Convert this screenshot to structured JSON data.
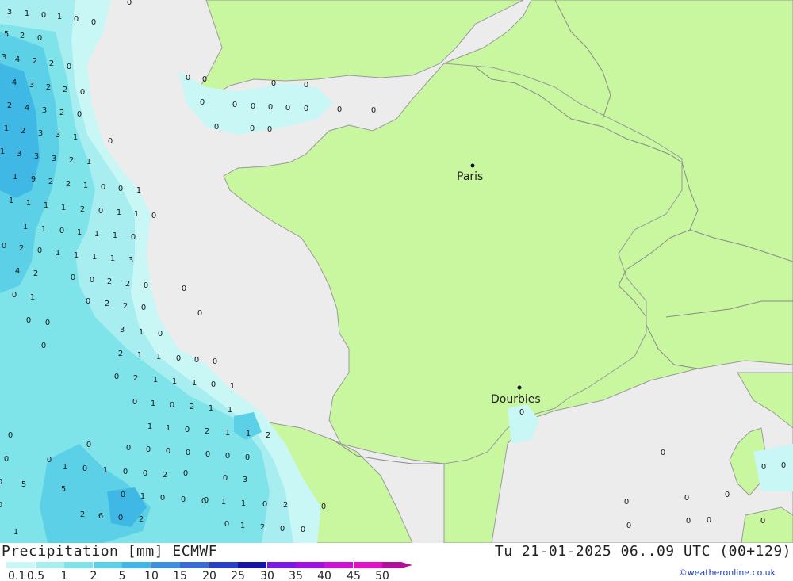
{
  "footer": {
    "title": "Precipitation [mm] ECMWF",
    "valid_time": "Tu 21-01-2025 06..09 UTC (00+129)",
    "credit": "©weatheronline.co.uk"
  },
  "legend": {
    "ticks": [
      "0.1",
      "0.5",
      "1",
      "2",
      "5",
      "10",
      "15",
      "20",
      "25",
      "30",
      "35",
      "40",
      "45",
      "50"
    ],
    "colors": [
      "#c8f7f5",
      "#a8eef0",
      "#7fe3ea",
      "#5cd0e6",
      "#40b8e6",
      "#3c8fe0",
      "#3a6ad8",
      "#2a3fc8",
      "#1414a8",
      "#7a18e6",
      "#a010e0",
      "#cc10d8",
      "#e010c8",
      "#b01098"
    ]
  },
  "cities": [
    {
      "name": "Paris"
    },
    {
      "name": "Dourbies"
    }
  ],
  "colors": {
    "land": "#c8f7a0",
    "sea": "#ececec",
    "border": "#8a8a8a",
    "coast": "#9a9a9a"
  },
  "precip_values": [
    "3",
    "1",
    "0",
    "1",
    "0",
    "0",
    "0",
    "5",
    "2",
    "0",
    "3",
    "4",
    "2",
    "2",
    "0",
    "4",
    "3",
    "2",
    "2",
    "0",
    "2",
    "4",
    "3",
    "2",
    "0",
    "1",
    "2",
    "3",
    "3",
    "1",
    "0",
    "1",
    "3",
    "3",
    "3",
    "2",
    "1",
    "1",
    "9",
    "2",
    "2",
    "1",
    "0",
    "0",
    "1",
    "1",
    "1",
    "1",
    "1",
    "2",
    "0",
    "1",
    "1",
    "0",
    "1",
    "1",
    "0",
    "1",
    "1",
    "1",
    "0",
    "0",
    "2",
    "0",
    "1",
    "1",
    "1",
    "1",
    "3",
    "4",
    "2",
    "0",
    "0",
    "2",
    "2",
    "0",
    "0",
    "1",
    "0",
    "2",
    "2",
    "0",
    "0",
    "0",
    "0",
    "3",
    "1",
    "0",
    "0",
    "0",
    "2",
    "1",
    "1",
    "0",
    "0",
    "0",
    "0",
    "2",
    "1",
    "1",
    "1",
    "0",
    "1",
    "0",
    "1",
    "0",
    "2",
    "1",
    "1",
    "1",
    "1",
    "0",
    "2",
    "1",
    "1",
    "2",
    "0",
    "0",
    "0",
    "0",
    "0",
    "0",
    "0",
    "0",
    "1",
    "0",
    "1",
    "0",
    "0",
    "2",
    "0",
    "3",
    "0",
    "5",
    "5",
    "0",
    "1",
    "0",
    "0",
    "0",
    "2",
    "6",
    "0",
    "2",
    "1",
    "1",
    "0",
    "2",
    "1",
    "1",
    "2",
    "0",
    "0",
    "0",
    "0",
    "0",
    "0",
    "0",
    "0",
    "0",
    "0",
    "0",
    "0",
    "0",
    "0",
    "0",
    "0",
    "0",
    "0",
    "0",
    "0",
    "0",
    "0",
    "0",
    "0",
    "0"
  ]
}
